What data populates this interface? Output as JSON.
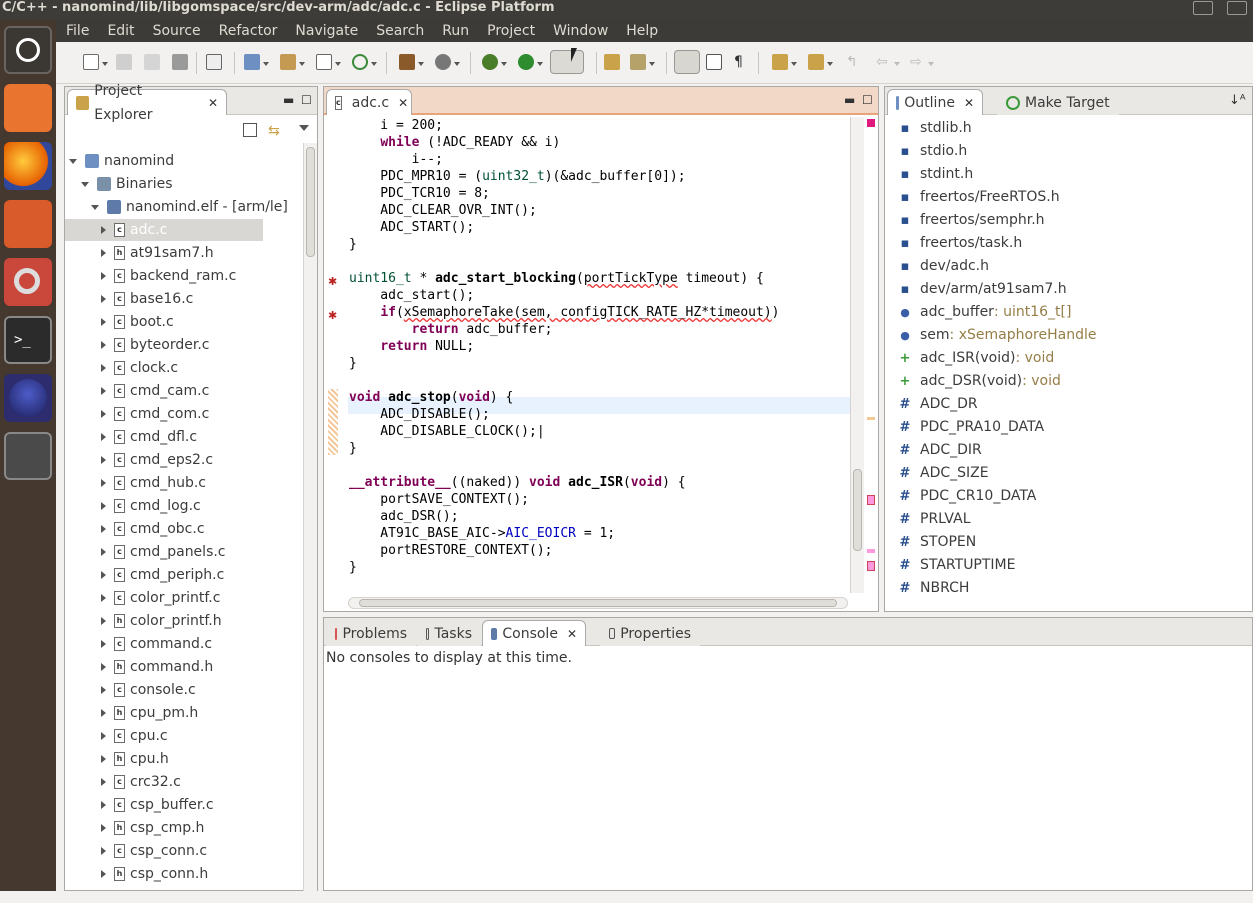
{
  "window_title": "C/C++ - nanomind/lib/libgomspace/src/dev-arm/adc/adc.c - Eclipse Platform",
  "menu": [
    "File",
    "Edit",
    "Source",
    "Refactor",
    "Navigate",
    "Search",
    "Run",
    "Project",
    "Window",
    "Help"
  ],
  "project_explorer": {
    "tab_label": "Project Explorer",
    "root": "nanomind",
    "binaries": "Binaries",
    "elf": "nanomind.elf - [arm/le]",
    "files": [
      "adc.c",
      "at91sam7.h",
      "backend_ram.c",
      "base16.c",
      "boot.c",
      "byteorder.c",
      "clock.c",
      "cmd_cam.c",
      "cmd_com.c",
      "cmd_dfl.c",
      "cmd_eps2.c",
      "cmd_hub.c",
      "cmd_log.c",
      "cmd_obc.c",
      "cmd_panels.c",
      "cmd_periph.c",
      "color_printf.c",
      "color_printf.h",
      "command.c",
      "command.h",
      "console.c",
      "cpu_pm.h",
      "cpu.c",
      "cpu.h",
      "crc32.c",
      "csp_buffer.c",
      "csp_cmp.h",
      "csp_conn.c",
      "csp_conn.h"
    ]
  },
  "editor": {
    "tab_label": "adc.c"
  },
  "outline": {
    "tab_label": "Outline",
    "tab2_label": "Make Target",
    "items": [
      {
        "icon": "include",
        "name": "stdlib.h",
        "type": ""
      },
      {
        "icon": "include",
        "name": "stdio.h",
        "type": ""
      },
      {
        "icon": "include",
        "name": "stdint.h",
        "type": ""
      },
      {
        "icon": "include",
        "name": "freertos/FreeRTOS.h",
        "type": ""
      },
      {
        "icon": "include",
        "name": "freertos/semphr.h",
        "type": ""
      },
      {
        "icon": "include",
        "name": "freertos/task.h",
        "type": ""
      },
      {
        "icon": "include",
        "name": "dev/adc.h",
        "type": ""
      },
      {
        "icon": "include",
        "name": "dev/arm/at91sam7.h",
        "type": ""
      },
      {
        "icon": "var",
        "name": "adc_buffer",
        "type": " : uint16_t[]"
      },
      {
        "icon": "var",
        "name": "sem",
        "type": " : xSemaphoreHandle"
      },
      {
        "icon": "func",
        "name": "adc_ISR(void)",
        "type": " : void"
      },
      {
        "icon": "func",
        "name": "adc_DSR(void)",
        "type": " : void"
      },
      {
        "icon": "macro",
        "name": "ADC_DR",
        "type": ""
      },
      {
        "icon": "macro",
        "name": "PDC_PRA10_DATA",
        "type": ""
      },
      {
        "icon": "macro",
        "name": "ADC_DIR",
        "type": ""
      },
      {
        "icon": "macro",
        "name": "ADC_SIZE",
        "type": ""
      },
      {
        "icon": "macro",
        "name": "PDC_CR10_DATA",
        "type": ""
      },
      {
        "icon": "macro",
        "name": "PRLVAL",
        "type": ""
      },
      {
        "icon": "macro",
        "name": "STOPEN",
        "type": ""
      },
      {
        "icon": "macro",
        "name": "STARTUPTIME",
        "type": ""
      },
      {
        "icon": "macro",
        "name": "NBRCH",
        "type": ""
      }
    ]
  },
  "bottom": {
    "tabs": [
      "Problems",
      "Tasks",
      "Console",
      "Properties"
    ],
    "message": "No consoles to display at this time."
  }
}
